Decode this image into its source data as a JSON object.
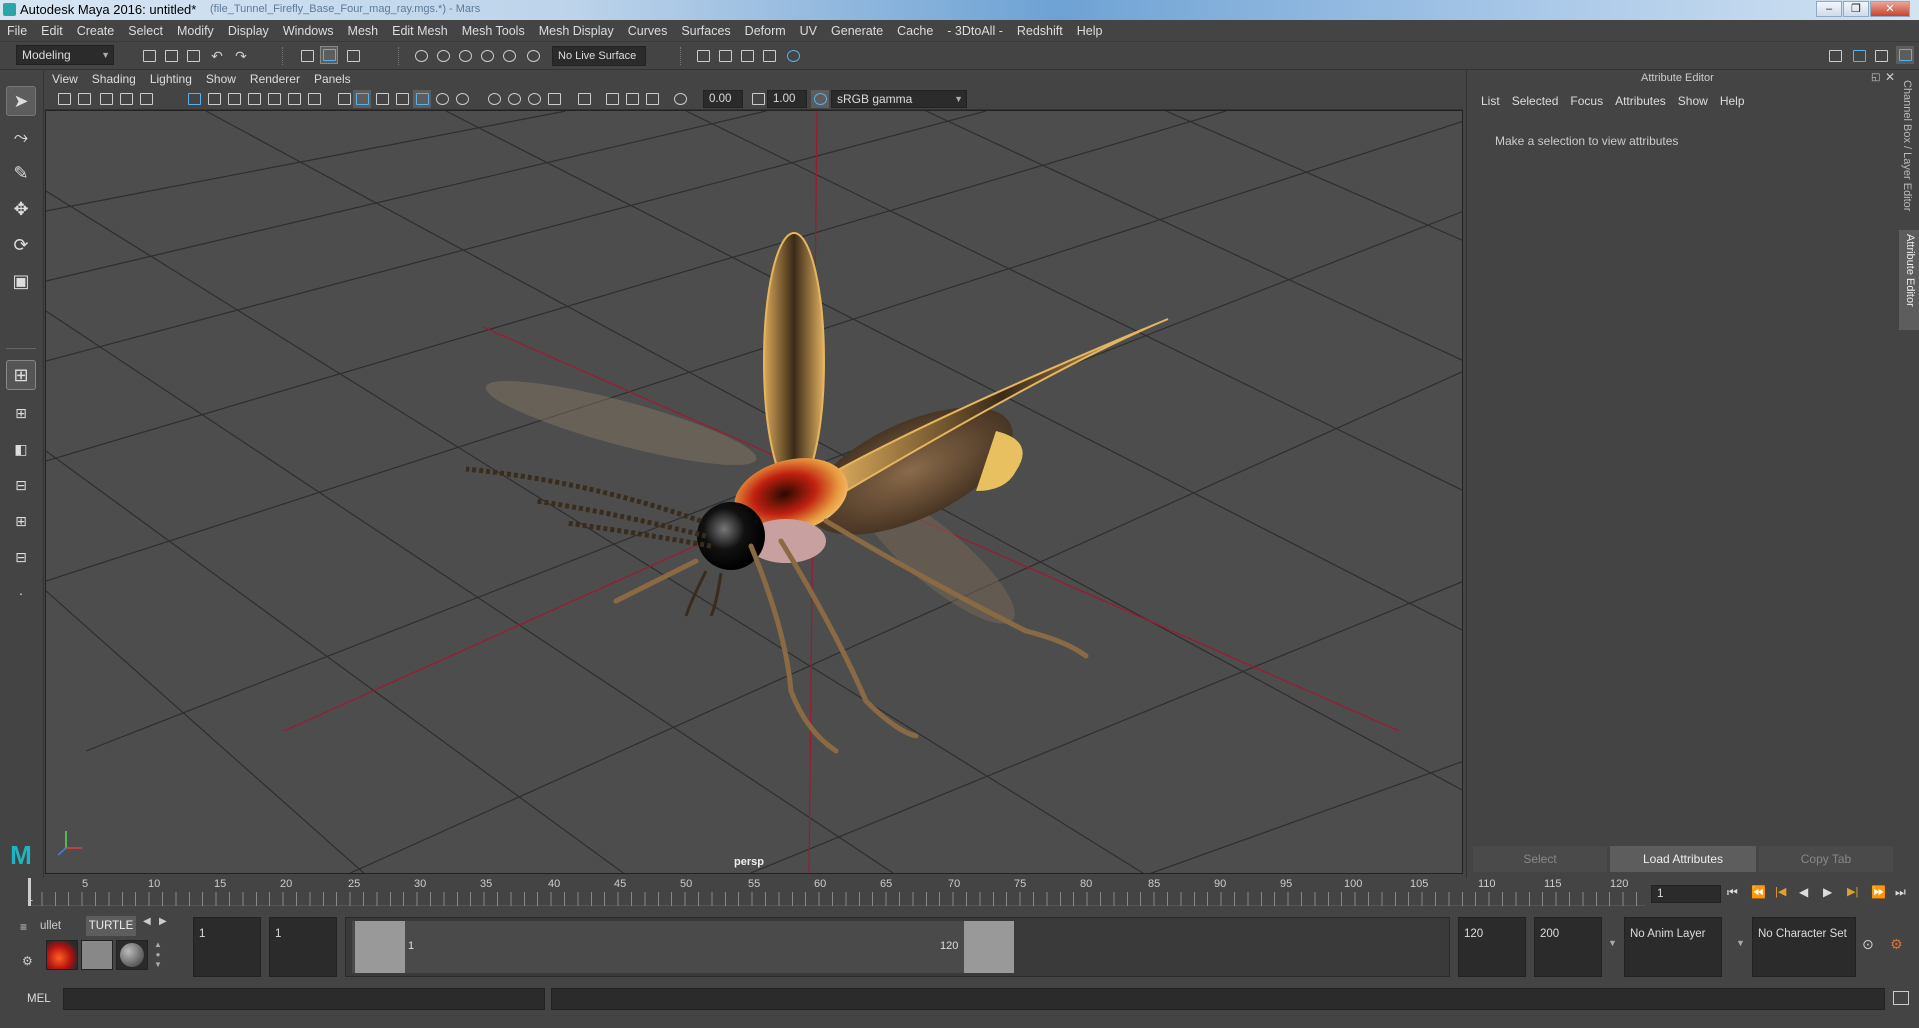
{
  "window": {
    "title": "Autodesk Maya 2016: untitled*",
    "path_faint": "(file_Tunnel_Firefly_Base_Four_mag_ray.mgs.*) - Mars",
    "controls": [
      "–",
      "❐",
      "✕"
    ]
  },
  "menubar": [
    "File",
    "Edit",
    "Create",
    "Select",
    "Modify",
    "Display",
    "Windows",
    "Mesh",
    "Edit Mesh",
    "Mesh Tools",
    "Mesh Display",
    "Curves",
    "Surfaces",
    "Deform",
    "UV",
    "Generate",
    "Cache",
    "- 3DtoAll -",
    "Redshift",
    "Help"
  ],
  "shelf": {
    "mode": "Modeling",
    "live_surface": "No Live Surface"
  },
  "viewport": {
    "menu": [
      "View",
      "Shading",
      "Lighting",
      "Show",
      "Renderer",
      "Panels"
    ],
    "exposure": "0.00",
    "gamma": "1.00",
    "colorspace": "sRGB gamma",
    "camera_label": "persp"
  },
  "attribute_editor": {
    "title": "Attribute Editor",
    "menu": [
      "List",
      "Selected",
      "Focus",
      "Attributes",
      "Show",
      "Help"
    ],
    "message": "Make a selection to view attributes",
    "buttons": {
      "select": "Select",
      "load": "Load Attributes",
      "copy": "Copy Tab"
    },
    "side_tabs": [
      "Channel Box / Layer Editor",
      "Attribute Editor"
    ]
  },
  "timeline": {
    "ticks": [
      "5",
      "10",
      "15",
      "20",
      "25",
      "30",
      "35",
      "40",
      "45",
      "50",
      "55",
      "60",
      "65",
      "70",
      "75",
      "80",
      "85",
      "90",
      "95",
      "100",
      "105",
      "110",
      "115",
      "120"
    ],
    "start_marker": "1",
    "current_frame": "1",
    "playback": [
      "⏮",
      "⏪",
      "|◀",
      "◀",
      "▶",
      "▶|",
      "⏩",
      "⏭"
    ]
  },
  "range": {
    "shelf_tabs": [
      "ullet",
      "TURTLE"
    ],
    "start": "1",
    "playback_start": "1",
    "slider_start": "1",
    "slider_end": "120",
    "playback_end": "120",
    "end": "200",
    "anim_layer": "No Anim Layer",
    "character_set": "No Character Set"
  },
  "command_line": {
    "label": "MEL"
  },
  "colors": {
    "bg": "#444444",
    "viewport": "#4d4d4d",
    "accent": "#5ab0e8",
    "selected_tab": "#5d5d5d"
  }
}
